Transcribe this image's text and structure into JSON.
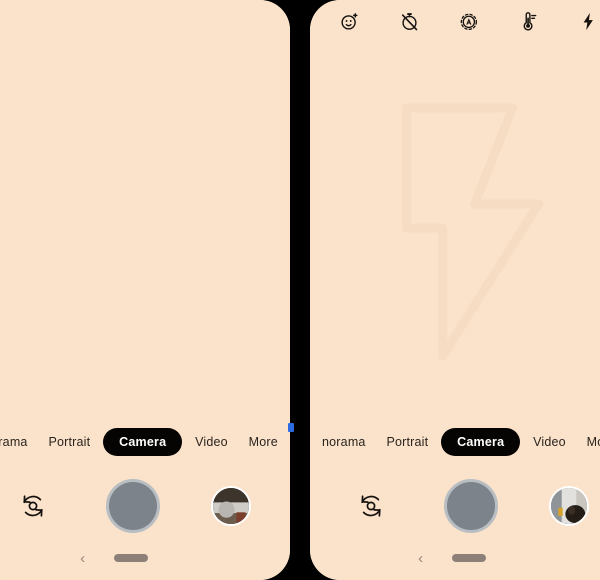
{
  "app": {
    "name": "Camera",
    "background_color": "#FBE3CB",
    "accent_color": "#050403",
    "gap_color": "#000000",
    "cursor_color": "#2F6BE0"
  },
  "panels": [
    {
      "id": "left-panel",
      "toolbar_visible": false,
      "watermark_visible": false,
      "thumbnail_variant": "landscape-photo"
    },
    {
      "id": "right-panel",
      "toolbar_visible": true,
      "watermark_visible": true,
      "thumbnail_variant": "portrait-photo"
    }
  ],
  "toolbar": {
    "icons": [
      {
        "name": "motion-photos-icon",
        "label": "Motion"
      },
      {
        "name": "timer-off-icon",
        "label": "Timer off"
      },
      {
        "name": "aspect-ratio-auto-icon",
        "label": "Auto"
      },
      {
        "name": "white-balance-icon",
        "label": "White balance"
      },
      {
        "name": "flash-icon",
        "label": "Flash"
      }
    ]
  },
  "watermark": {
    "name": "flash-bolt-watermark",
    "label": "Flash"
  },
  "modes": {
    "items": [
      {
        "label": "norama",
        "full_label": "Panorama",
        "selected": false,
        "truncated": true
      },
      {
        "label": "Portrait",
        "full_label": "Portrait",
        "selected": false,
        "truncated": false
      },
      {
        "label": "Camera",
        "full_label": "Camera",
        "selected": true,
        "truncated": false
      },
      {
        "label": "Video",
        "full_label": "Video",
        "selected": false,
        "truncated": false
      },
      {
        "label": "More",
        "full_label": "More",
        "selected": false,
        "truncated": false
      }
    ]
  },
  "controls": {
    "flip_label": "Switch camera",
    "shutter_label": "Shutter",
    "gallery_label": "Gallery thumbnail",
    "shutter_color": "#7C838A",
    "shutter_ring_color": "#B9BEC2"
  },
  "navbar": {
    "back_glyph": "‹",
    "back_label": "Back",
    "home_label": "Home"
  }
}
